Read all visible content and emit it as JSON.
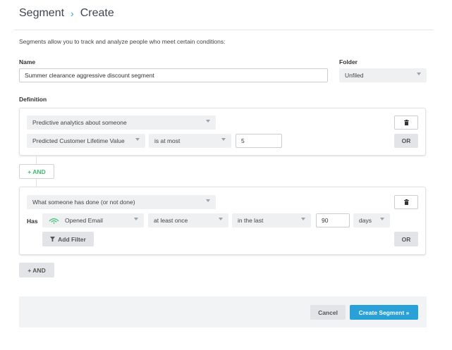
{
  "breadcrumb": {
    "section": "Segment",
    "separator": "›",
    "current": "Create"
  },
  "intro": "Segments allow you to track and analyze people who meet certain conditions:",
  "name_field": {
    "label": "Name",
    "value": "Summer clearance aggressive discount segment"
  },
  "folder_field": {
    "label": "Folder",
    "value": "Unfiled"
  },
  "definition_label": "Definition",
  "condition_group_1": {
    "type_select": "Predictive analytics about someone",
    "metric_select": "Predicted Customer Lifetime Value",
    "operator_select": "is at most",
    "value": "5",
    "or_label": "OR"
  },
  "and_button_1": "+ AND",
  "condition_group_2": {
    "type_select": "What someone has done (or not done)",
    "has_label": "Has",
    "event_select": "Opened Email",
    "frequency_select": "at least once",
    "timeframe_select": "in the last",
    "value": "90",
    "unit_select": "days",
    "add_filter_label": "Add Filter",
    "or_label": "OR"
  },
  "and_button_2": "+ AND",
  "footer": {
    "cancel_label": "Cancel",
    "create_label": "Create Segment »"
  },
  "colors": {
    "accent": "#29a0d8",
    "and_green": "#3bbf6f",
    "text": "#333333"
  },
  "icons": {
    "trash": "trash-icon",
    "email": "email-signal-icon",
    "filter": "filter-icon"
  }
}
